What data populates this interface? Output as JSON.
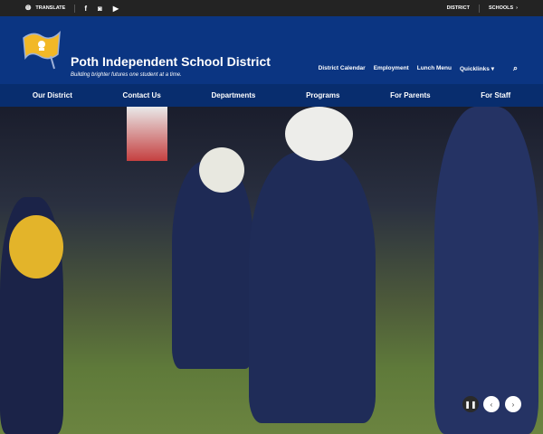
{
  "topbar": {
    "translate": "TRANSLATE",
    "district": "DISTRICT",
    "schools": "SCHOOLS"
  },
  "header": {
    "title": "Poth Independent School District",
    "tagline": "Building brighter futures one student at a time."
  },
  "utility": [
    "District Calendar",
    "Employment",
    "Lunch Menu",
    "Quicklinks"
  ],
  "nav": [
    "Our District",
    "Contact Us",
    "Departments",
    "Programs",
    "For Parents",
    "For Staff"
  ],
  "colors": {
    "header": "#0b3582",
    "nav": "#082d6e",
    "topbar": "#232323",
    "gold": "#f2b827"
  }
}
